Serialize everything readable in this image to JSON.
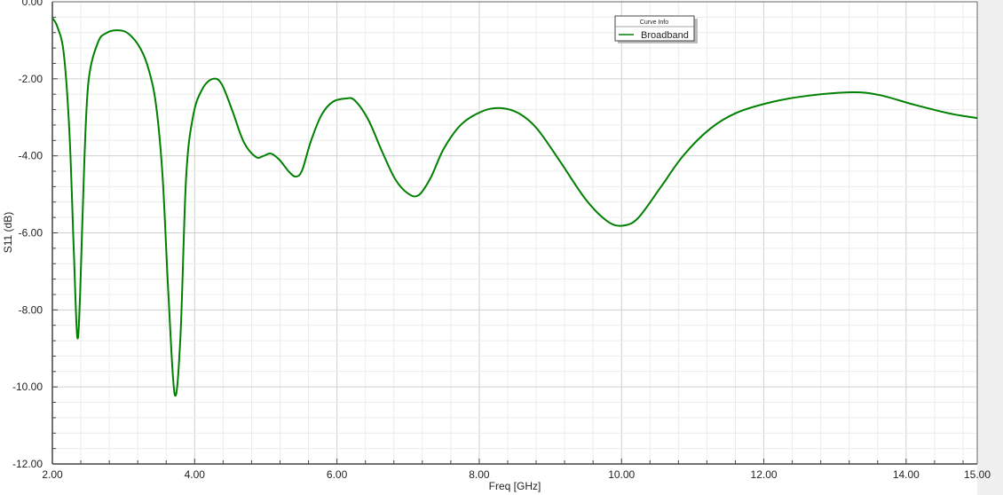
{
  "chart_data": {
    "type": "line",
    "title": "",
    "xlabel": "Freq [GHz]",
    "ylabel": "S11 (dB)",
    "xlim": [
      2.0,
      15.0
    ],
    "ylim": [
      -12.0,
      0.0
    ],
    "xticks": [
      "2.00",
      "4.00",
      "6.00",
      "8.00",
      "10.00",
      "12.00",
      "14.00",
      "15.00"
    ],
    "xtick_values": [
      2,
      4,
      6,
      8,
      10,
      12,
      14,
      15
    ],
    "yticks": [
      "0.00",
      "-2.00",
      "-4.00",
      "-6.00",
      "-8.00",
      "-10.00",
      "-12.00"
    ],
    "ytick_values": [
      0,
      -2,
      -4,
      -6,
      -8,
      -10,
      -12
    ],
    "grid": true,
    "legend": {
      "title": "Curve Info",
      "placement": "top-center-right",
      "entries": [
        "Broadband"
      ]
    },
    "colors": {
      "series": "#008000",
      "major_grid": "#d0d0d0",
      "minor_grid": "#ececec"
    },
    "series": [
      {
        "name": "Broadband",
        "x": [
          2.0,
          2.07,
          2.16,
          2.24,
          2.3,
          2.35,
          2.39,
          2.45,
          2.51,
          2.64,
          2.76,
          2.92,
          3.07,
          3.24,
          3.36,
          3.46,
          3.55,
          3.63,
          3.72,
          3.8,
          3.88,
          3.98,
          4.11,
          4.26,
          4.38,
          4.53,
          4.69,
          4.86,
          4.97,
          5.07,
          5.19,
          5.32,
          5.42,
          5.51,
          5.63,
          5.78,
          5.94,
          6.13,
          6.25,
          6.44,
          6.63,
          6.82,
          7.0,
          7.15,
          7.32,
          7.5,
          7.75,
          8.06,
          8.31,
          8.56,
          8.81,
          9.12,
          9.5,
          9.81,
          10.03,
          10.24,
          10.56,
          10.87,
          11.25,
          11.62,
          12.12,
          12.62,
          13.24,
          13.62,
          14.11,
          14.61,
          15.0
        ],
        "y": [
          -0.42,
          -0.65,
          -1.34,
          -3.4,
          -6.4,
          -8.7,
          -7.6,
          -4.1,
          -2.03,
          -1.06,
          -0.81,
          -0.74,
          -0.83,
          -1.22,
          -1.8,
          -2.72,
          -4.56,
          -7.56,
          -10.2,
          -8.7,
          -4.56,
          -2.95,
          -2.26,
          -2.0,
          -2.14,
          -2.83,
          -3.64,
          -4.03,
          -4.0,
          -3.94,
          -4.1,
          -4.4,
          -4.54,
          -4.38,
          -3.64,
          -2.95,
          -2.6,
          -2.51,
          -2.56,
          -3.06,
          -3.87,
          -4.61,
          -4.98,
          -5.02,
          -4.56,
          -3.82,
          -3.18,
          -2.83,
          -2.76,
          -2.9,
          -3.29,
          -4.1,
          -5.14,
          -5.71,
          -5.81,
          -5.6,
          -4.79,
          -3.99,
          -3.29,
          -2.88,
          -2.6,
          -2.44,
          -2.35,
          -2.42,
          -2.67,
          -2.9,
          -3.02
        ]
      }
    ]
  }
}
